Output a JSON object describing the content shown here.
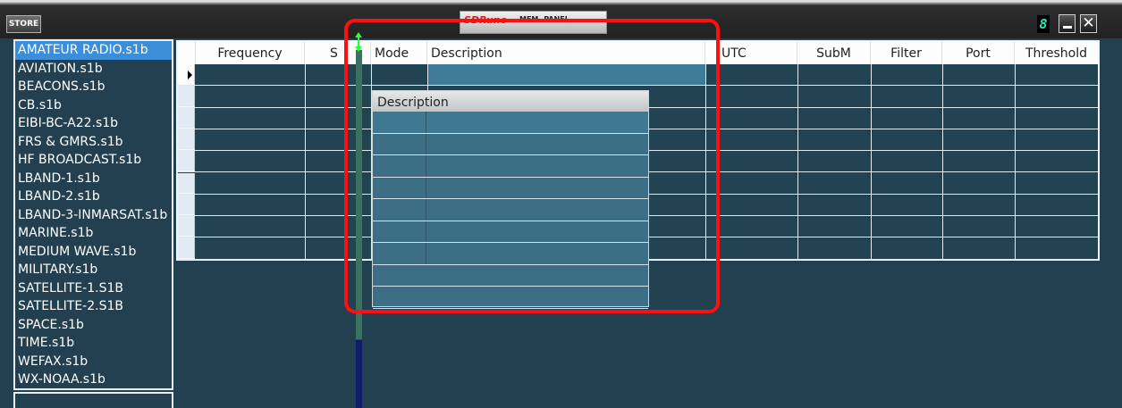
{
  "titlebar": {
    "store_label": "STORE",
    "brand_sd": "SDRuno",
    "brand_panel": "MEM. PANEL",
    "led_digit": "8",
    "close_glyph": "✕"
  },
  "files": {
    "selected_index": 0,
    "items": [
      "AMATEUR RADIO.s1b",
      "AVIATION.s1b",
      "BEACONS.s1b",
      "CB.s1b",
      "EIBI-BC-A22.s1b",
      "FRS & GMRS.s1b",
      "HF BROADCAST.s1b",
      "LBAND-1.s1b",
      "LBAND-2.s1b",
      "LBAND-3-INMARSAT.s1b",
      "MARINE.s1b",
      "MEDIUM WAVE.s1b",
      "MILITARY.s1b",
      "SATELLITE-1.S1B",
      "SATELLITE-2.S1B",
      "SPACE.s1b",
      "TIME.s1b",
      "WEFAX.s1b",
      "WX-NOAA.s1b"
    ]
  },
  "grid": {
    "columns": {
      "frequency": "Frequency",
      "s": "S",
      "mode": "Mode",
      "description": "Description",
      "utc": "UTC",
      "subm": "SubM",
      "filter": "Filter",
      "port": "Port",
      "threshold": "Threshold"
    },
    "row_count": 9,
    "current_row": 0
  },
  "dropdown": {
    "header": "Description",
    "row_count": 9
  },
  "colors": {
    "background": "#22404f",
    "selection": "#3d8ed8",
    "highlight": "#ff1010",
    "led": "#31e0b5"
  }
}
